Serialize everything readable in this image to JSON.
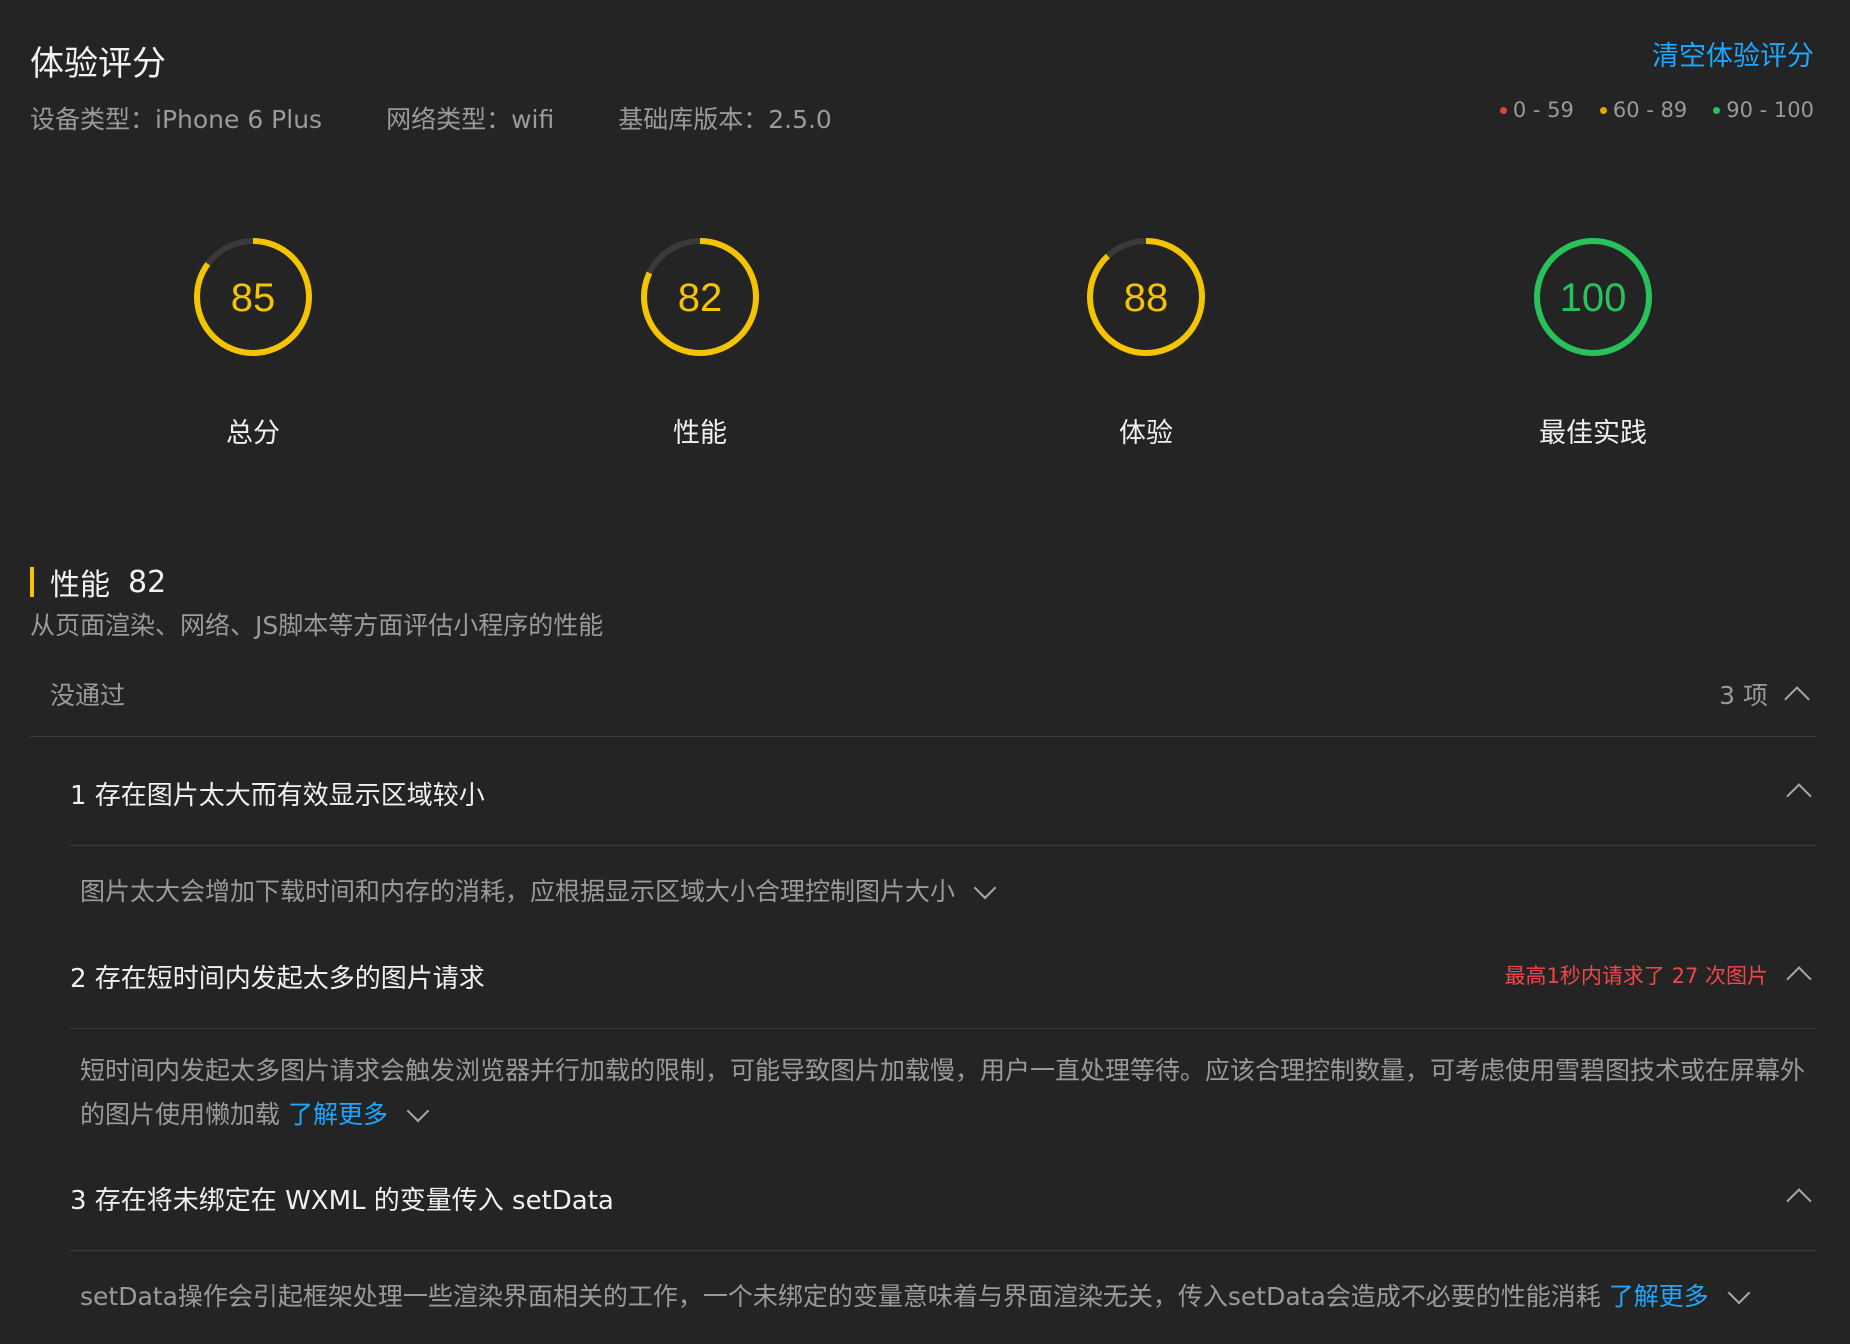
{
  "header": {
    "title": "体验评分",
    "clear_label": "清空体验评分",
    "meta": [
      {
        "label": "设备类型：iPhone 6 Plus"
      },
      {
        "label": "网络类型：wifi"
      },
      {
        "label": "基础库版本：2.5.0"
      }
    ],
    "legend": [
      {
        "range": "0 - 59",
        "color": "#e5413b"
      },
      {
        "range": "60 - 89",
        "color": "#e6a700"
      },
      {
        "range": "90 - 100",
        "color": "#28c25a"
      }
    ]
  },
  "colors": {
    "accent": "#1ea7ff",
    "warning": "#f5c400",
    "good": "#28c25a",
    "bad": "#f0474b"
  },
  "scores": [
    {
      "label": "总分",
      "value": 85
    },
    {
      "label": "性能",
      "value": 82
    },
    {
      "label": "体验",
      "value": 88
    },
    {
      "label": "最佳实践",
      "value": 100
    }
  ],
  "section": {
    "title": "性能",
    "score": "82",
    "description": "从页面渲染、网络、JS脚本等方面评估小程序的性能",
    "group": {
      "name": "没通过",
      "count": "3 项"
    },
    "items": [
      {
        "title": "1 存在图片太大而有效显示区域较小",
        "warning": "",
        "description": "图片太大会增加下载时间和内存的消耗，应根据显示区域大小合理控制图片大小",
        "learn_more": ""
      },
      {
        "title": "2 存在短时间内发起太多的图片请求",
        "warning": "最高1秒内请求了 27 次图片",
        "description": "短时间内发起太多图片请求会触发浏览器并行加载的限制，可能导致图片加载慢，用户一直处理等待。应该合理控制数量，可考虑使用雪碧图技术或在屏幕外的图片使用懒加载",
        "learn_more": "了解更多"
      },
      {
        "title": "3 存在将未绑定在 WXML 的变量传入 setData",
        "warning": "",
        "description": "setData操作会引起框架处理一些渲染界面相关的工作，一个未绑定的变量意味着与界面渲染无关，传入setData会造成不必要的性能消耗",
        "learn_more": "了解更多"
      }
    ]
  }
}
